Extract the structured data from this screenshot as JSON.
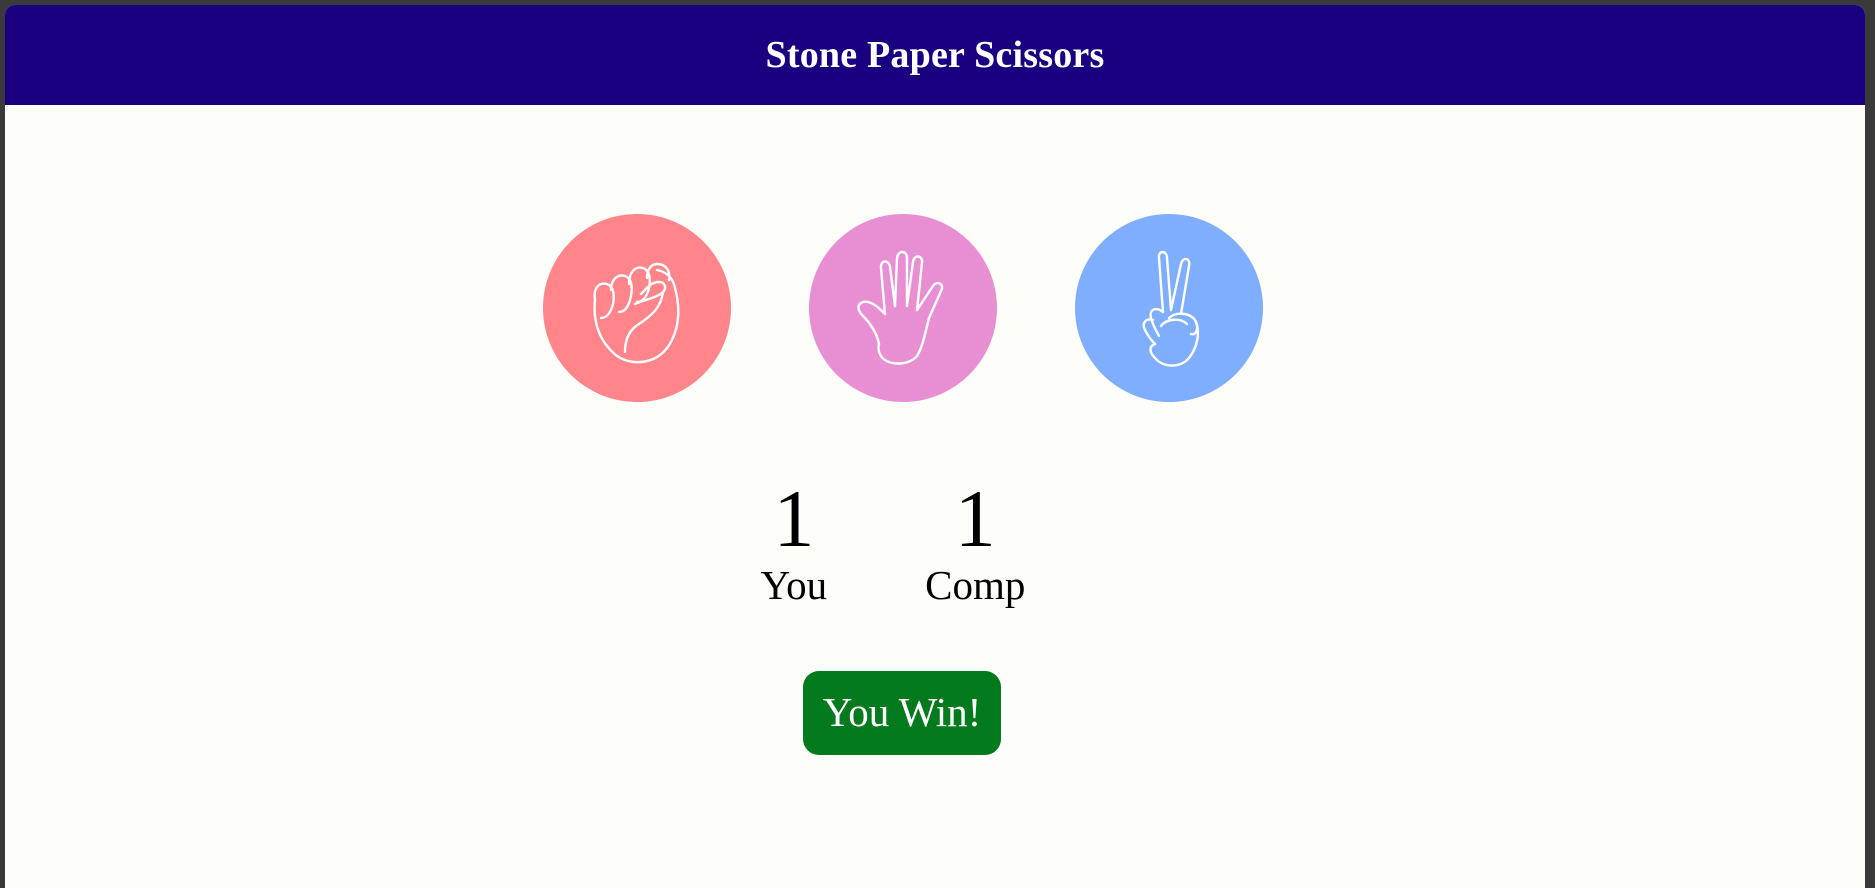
{
  "header": {
    "title": "Stone Paper Scissors",
    "background_color": "#1a0080"
  },
  "choices": [
    {
      "id": "rock",
      "icon": "fist-icon",
      "color": "#ff858b"
    },
    {
      "id": "paper",
      "icon": "open-hand-icon",
      "color": "#e88fd3"
    },
    {
      "id": "scissors",
      "icon": "peace-hand-icon",
      "color": "#7faeff"
    }
  ],
  "scores": {
    "user": {
      "value": "1",
      "label": "You"
    },
    "comp": {
      "value": "1",
      "label": "Comp"
    }
  },
  "message": {
    "text": "You Win!",
    "color": "#037a1d"
  }
}
